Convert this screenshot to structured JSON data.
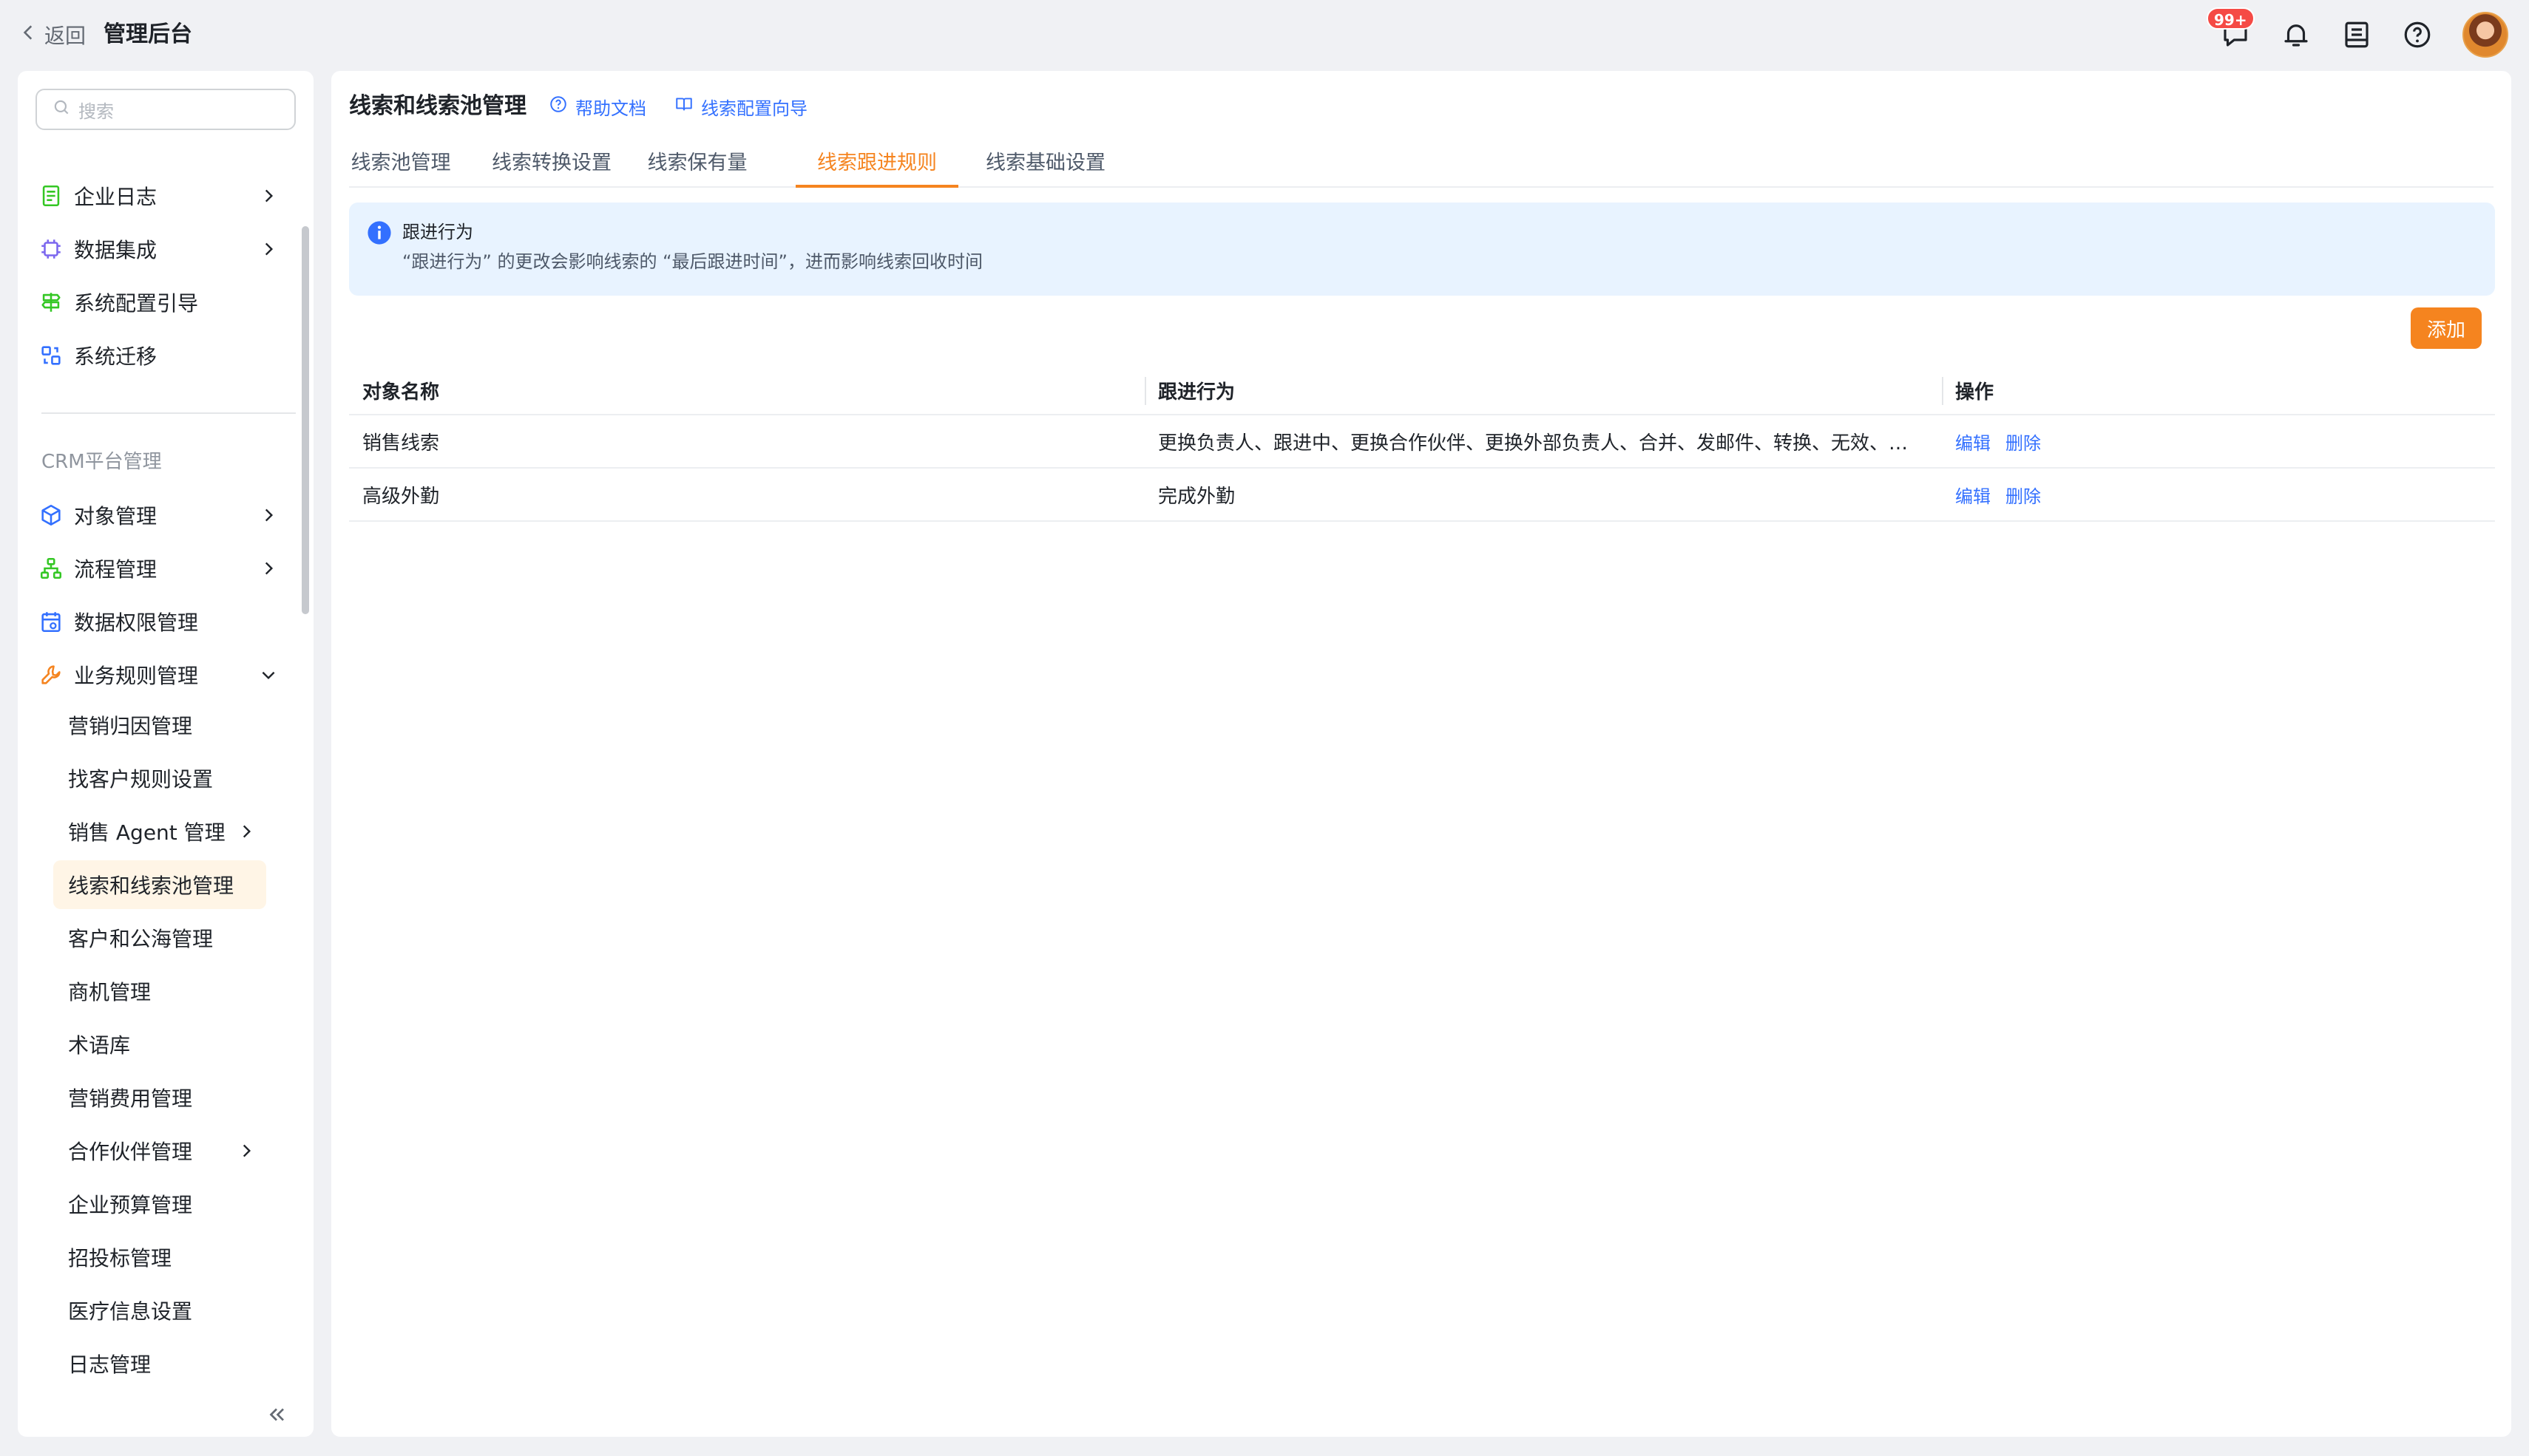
{
  "topbar": {
    "back_label": "返回",
    "app_title": "管理后台",
    "message_badge": "99+",
    "icons": [
      "chat-icon",
      "bell-icon",
      "inbox-icon",
      "help-icon",
      "avatar"
    ]
  },
  "sidebar": {
    "search_placeholder": "搜索",
    "items": [
      {
        "label": "企业日志",
        "icon": "log-icon",
        "has_arrow": true,
        "color": "#34c724"
      },
      {
        "label": "数据集成",
        "icon": "chip-icon",
        "has_arrow": true,
        "color": "#7b67ee"
      },
      {
        "label": "系统配置引导",
        "icon": "signpost-icon",
        "has_arrow": false,
        "color": "#34c724"
      },
      {
        "label": "系统迁移",
        "icon": "migrate-icon",
        "has_arrow": false,
        "color": "#3370ff"
      }
    ],
    "group_label": "CRM平台管理",
    "crm_items": [
      {
        "label": "对象管理",
        "icon": "cube-icon",
        "has_arrow": true,
        "color": "#3370ff"
      },
      {
        "label": "流程管理",
        "icon": "flow-icon",
        "has_arrow": true,
        "color": "#34c724"
      },
      {
        "label": "数据权限管理",
        "icon": "permission-icon",
        "has_arrow": false,
        "color": "#3370ff"
      },
      {
        "label": "业务规则管理",
        "icon": "wrench-icon",
        "has_arrow": true,
        "expanded": true,
        "color": "#f5841f"
      }
    ],
    "sub_items": [
      {
        "label": "营销归因管理"
      },
      {
        "label": "找客户规则设置"
      },
      {
        "label": "销售 Agent 管理",
        "has_arrow": true
      },
      {
        "label": "线索和线索池管理",
        "active": true
      },
      {
        "label": "客户和公海管理"
      },
      {
        "label": "商机管理"
      },
      {
        "label": "术语库"
      },
      {
        "label": "营销费用管理"
      },
      {
        "label": "合作伙伴管理",
        "has_arrow": true
      },
      {
        "label": "企业预算管理"
      },
      {
        "label": "招投标管理"
      },
      {
        "label": "医疗信息设置"
      },
      {
        "label": "日志管理"
      }
    ]
  },
  "main": {
    "title": "线索和线索池管理",
    "help_link": "帮助文档",
    "guide_link": "线索配置向导",
    "tabs": [
      {
        "label": "线索池管理"
      },
      {
        "label": "线索转换设置"
      },
      {
        "label": "线索保有量"
      },
      {
        "label": "线索跟进规则",
        "active": true
      },
      {
        "label": "线索基础设置"
      }
    ],
    "alert": {
      "title": "跟进行为",
      "description": "“跟进行为” 的更改会影响线索的 “最后跟进时间”，进而影响线索回收时间"
    },
    "add_button": "添加",
    "table": {
      "columns": [
        "对象名称",
        "跟进行为",
        "操作"
      ],
      "rows": [
        {
          "name": "销售线索",
          "behavior": "更换负责人、跟进中、更换合作伙伴、更换外部负责人、合并、发邮件、转换、无效、转换线索、新建跟进记录",
          "edit": "编辑",
          "delete": "删除"
        },
        {
          "name": "高级外勤",
          "behavior": "完成外勤",
          "edit": "编辑",
          "delete": "删除"
        }
      ]
    },
    "accent_color": "#f5841f",
    "link_color": "#3370ff"
  }
}
